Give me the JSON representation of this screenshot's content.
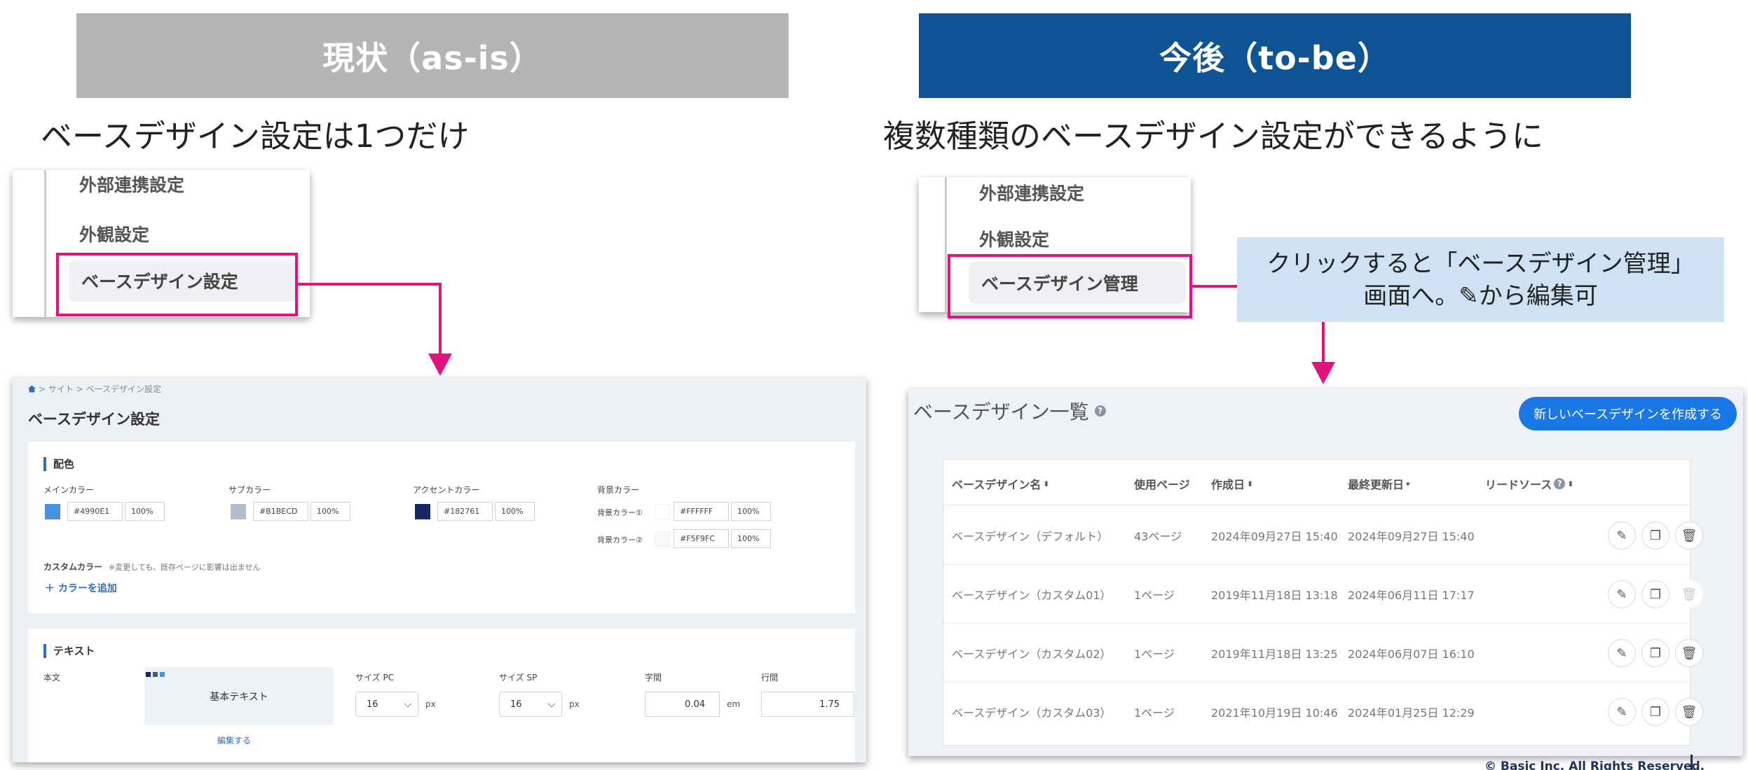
{
  "headers": {
    "asis": "現状（as-is）",
    "tobe": "今後（to-be）"
  },
  "subheads": {
    "asis": "ベースデザイン設定は1つだけ",
    "tobe": "複数種類のベースデザイン設定ができるように"
  },
  "menu_asis": {
    "items": [
      "外部連携設定",
      "外観設定",
      "ベースデザイン設定"
    ]
  },
  "menu_tobe": {
    "items": [
      "外部連携設定",
      "外観設定",
      "ベースデザイン管理"
    ]
  },
  "note": {
    "line1": "クリックすると「ベースデザイン管理」",
    "line2": "画面へ。✎から編集可"
  },
  "asis_screen": {
    "breadcrumb": [
      "> サイト > ベースデザイン設定"
    ],
    "title": "ベースデザイン設定",
    "color_section": {
      "heading": "配色",
      "main": {
        "label": "メインカラー",
        "hex": "#4990E1",
        "opacity": "100%",
        "color": "#4990E1"
      },
      "sub": {
        "label": "サブカラー",
        "hex": "#B1BECD",
        "opacity": "100%",
        "color": "#B1BECD"
      },
      "accent": {
        "label": "アクセントカラー",
        "hex": "#182761",
        "opacity": "100%",
        "color": "#182761"
      },
      "bg_label": "背景カラー",
      "bg1": {
        "label": "背景カラー①",
        "hex": "#FFFFFF",
        "opacity": "100%",
        "color": "#FFFFFF"
      },
      "bg2": {
        "label": "背景カラー②",
        "hex": "#F5F9FC",
        "opacity": "100%",
        "color": "#F5F9FC"
      },
      "custom_label": "カスタムカラー",
      "custom_note": "※変更しても、既存ページに影響は出ません",
      "add_color": "＋ カラーを追加"
    },
    "text_section": {
      "heading": "テキスト",
      "body_label": "本文",
      "preview_text": "基本テキスト",
      "edit_link": "編集する",
      "size_pc_label": "サイズ PC",
      "size_pc_value": "16",
      "size_sp_label": "サイズ SP",
      "size_sp_value": "16",
      "px_unit": "px",
      "letter_label": "字間",
      "letter_value": "0.04",
      "em_unit": "em",
      "line_label": "行間",
      "line_value": "1.75"
    }
  },
  "tobe_screen": {
    "title": "ベースデザイン一覧",
    "new_button": "新しいベースデザインを作成する",
    "columns": [
      "ベースデザイン名",
      "使用ページ",
      "作成日",
      "最終更新日",
      "リードソース"
    ],
    "rows": [
      {
        "name": "ベースデザイン（デフォルト）",
        "pages": "43ページ",
        "created": "2024年09月27日 15:40",
        "updated": "2024年09月27日 15:40",
        "delete_enabled": "false"
      },
      {
        "name": "ベースデザイン（カスタム01）",
        "pages": "1ページ",
        "created": "2019年11月18日 13:18",
        "updated": "2024年06月11日 17:17",
        "delete_enabled": "false"
      },
      {
        "name": "ベースデザイン（カスタム02）",
        "pages": "1ページ",
        "created": "2019年11月18日 13:25",
        "updated": "2024年06月07日 16:10",
        "delete_enabled": "true"
      },
      {
        "name": "ベースデザイン（カスタム03）",
        "pages": "1ページ",
        "created": "2021年10月19日 10:46",
        "updated": "2024年01月25日 12:29",
        "delete_enabled": "true"
      }
    ]
  },
  "footer": {
    "copyright": "© Basic Inc. All Rights Reserved."
  },
  "colors": {
    "pink": "#e4127f",
    "header_gray": "#b5b5b5",
    "header_blue": "#0e5394",
    "note_bg": "#cfe2f3",
    "accent_blue": "#1a78e6"
  }
}
